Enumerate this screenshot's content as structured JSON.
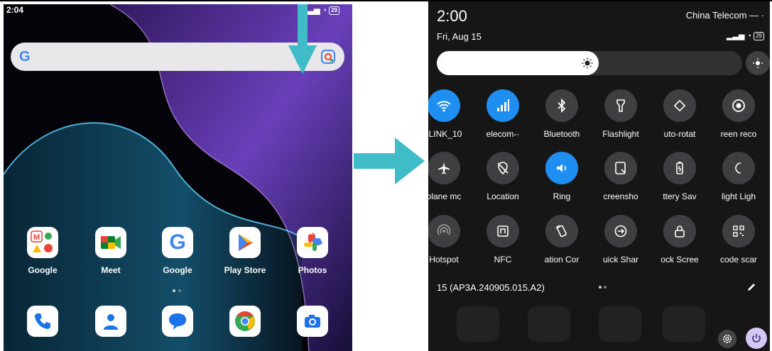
{
  "left_phone": {
    "status_bar": {
      "time": "2:04",
      "battery": "29"
    },
    "search": {
      "logo": "G"
    },
    "apps_row1": [
      {
        "label": "Google",
        "icon": "google-folder-icon"
      },
      {
        "label": "Meet",
        "icon": "meet-icon"
      },
      {
        "label": "Google",
        "icon": "google-app-icon"
      },
      {
        "label": "Play Store",
        "icon": "play-store-icon"
      },
      {
        "label": "Photos",
        "icon": "photos-icon"
      }
    ],
    "dock": [
      {
        "icon": "phone-icon"
      },
      {
        "icon": "contacts-icon"
      },
      {
        "icon": "messages-icon"
      },
      {
        "icon": "chrome-icon"
      },
      {
        "icon": "camera-icon"
      }
    ]
  },
  "right_phone": {
    "time": "2:00",
    "date": "Fri, Aug 15",
    "carrier": "China Telecom — ·",
    "battery": "29",
    "brightness_level": 0.53,
    "tiles": [
      {
        "label": "-LINK_10",
        "icon": "wifi-icon",
        "on": true
      },
      {
        "label": "elecom-·",
        "icon": "signal-icon",
        "on": true
      },
      {
        "label": "Bluetooth",
        "icon": "bluetooth-icon",
        "on": false
      },
      {
        "label": "Flashlight",
        "icon": "flashlight-icon",
        "on": false
      },
      {
        "label": "uto-rotat",
        "icon": "rotate-icon",
        "on": false
      },
      {
        "label": "reen reco",
        "icon": "screen-record-icon",
        "on": false
      },
      {
        "label": "plane mc",
        "icon": "airplane-icon",
        "on": false
      },
      {
        "label": "Location",
        "icon": "location-off-icon",
        "on": false
      },
      {
        "label": "Ring",
        "icon": "ring-icon",
        "on": true
      },
      {
        "label": "creensho",
        "icon": "screenshot-icon",
        "on": false
      },
      {
        "label": "ttery Sav",
        "icon": "battery-saver-icon",
        "on": false
      },
      {
        "label": "light Ligh",
        "icon": "night-light-icon",
        "on": false
      },
      {
        "label": "Hotspot",
        "icon": "hotspot-icon",
        "on": false
      },
      {
        "label": "NFC",
        "icon": "nfc-icon",
        "on": false
      },
      {
        "label": "ation Cor",
        "icon": "rotation-control-icon",
        "on": false
      },
      {
        "label": "uick Shar",
        "icon": "quick-share-icon",
        "on": false
      },
      {
        "label": "ock Scree",
        "icon": "lock-screen-icon",
        "on": false
      },
      {
        "label": "code scar",
        "icon": "qr-scan-icon",
        "on": false
      }
    ],
    "build": "15 (AP3A.240905.015.A2)"
  },
  "colors": {
    "tile_on": "#1f8ef1",
    "tile_off": "#3f3f41",
    "arrow": "#3fbcc8",
    "power": "#d5c8f5"
  }
}
